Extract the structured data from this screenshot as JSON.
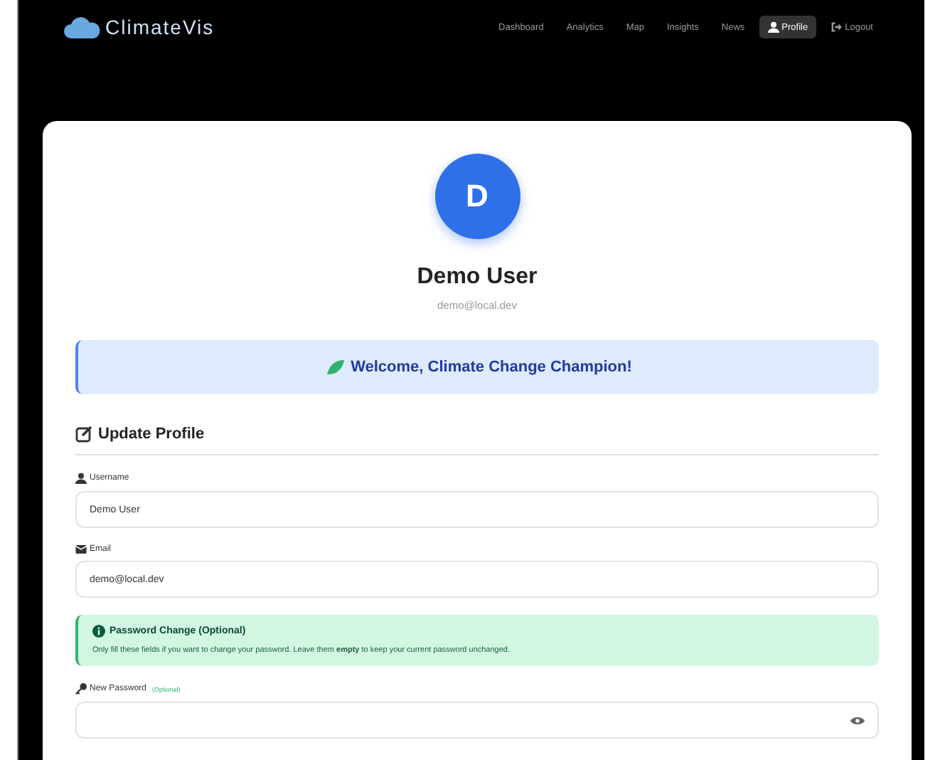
{
  "brand": {
    "name": "ClimateVis"
  },
  "nav": [
    {
      "label": "Dashboard",
      "selected": false,
      "kind": "text"
    },
    {
      "label": "Analytics",
      "selected": false,
      "kind": "text"
    },
    {
      "label": "Map",
      "selected": false,
      "kind": "text"
    },
    {
      "label": "Insights",
      "selected": false,
      "kind": "text"
    },
    {
      "label": "News",
      "selected": false,
      "kind": "text"
    },
    {
      "label": "Profile",
      "selected": true,
      "kind": "user"
    },
    {
      "label": "Logout",
      "selected": false,
      "kind": "logout"
    }
  ],
  "profile": {
    "initial": "D",
    "name": "Demo User",
    "email": "demo@local.dev"
  },
  "welcome": "Welcome, Climate Change Champion!",
  "section_title": "Update Profile",
  "fields": [
    {
      "label": "Username",
      "kind": "user",
      "value": "Demo User"
    },
    {
      "label": "Email",
      "kind": "mail",
      "value": "demo@local.dev"
    }
  ],
  "alert": {
    "title": "Password Change (Optional)",
    "text": "Only fill these fields if you want to change your password. Leave them **empty** to keep your current password unchanged."
  },
  "password_field": {
    "label": "New Password",
    "hint": "(Optional)"
  }
}
